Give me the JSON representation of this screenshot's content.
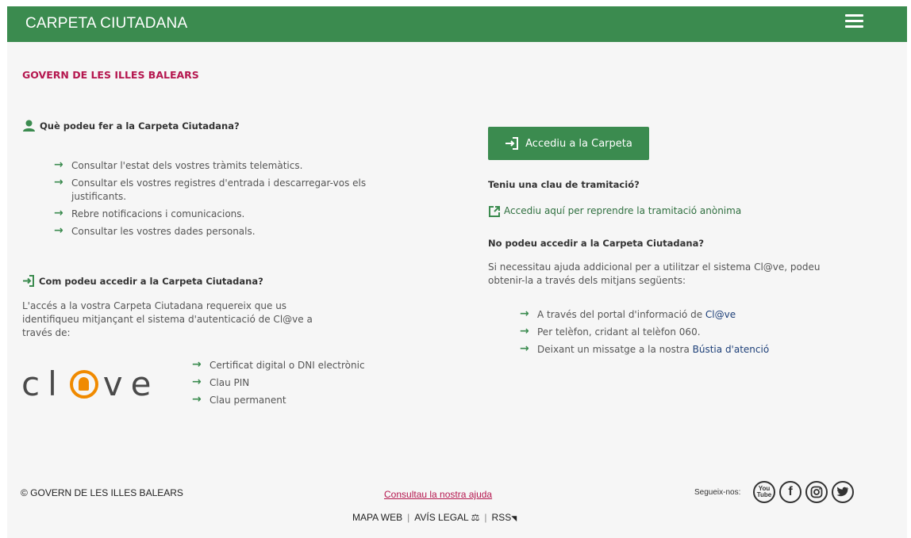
{
  "header": {
    "title": "CARPETA CIUTADANA"
  },
  "gov_name": "GOVERN DE LES ILLES BALEARS",
  "left": {
    "what_title": "Què podeu fer a la Carpeta Ciutadana?",
    "what_items": [
      "Consultar l'estat dels vostres tràmits telemàtics.",
      "Consultar els vostres registres d'entrada i descarregar-vos els justificants.",
      "Rebre notificacions i comunicacions.",
      "Consultar les vostres dades personals."
    ],
    "how_title": "Com podeu accedir a la Carpeta Ciutadana?",
    "how_text": "L'accés a la vostra Carpeta Ciutadana requereix que us identifiqueu mitjançant el sistema d'autenticació de Cl@ve a través de:",
    "clave_logo_text": "cl@ve",
    "clave_items": [
      "Certificat digital o DNI electrònic",
      "Clau PIN",
      "Clau permanent"
    ]
  },
  "right": {
    "access_button": "Accediu a la Carpeta",
    "key_title": "Teniu una clau de tramitació?",
    "key_link": "Accediu aquí per reprendre la tramitació anònima",
    "noaccess_title": "No podeu accedir a la Carpeta Ciutadana?",
    "noaccess_text": "Si necessitau ajuda addicional per a utilitzar el sistema Cl@ve, podeu obtenir-la a través dels mitjans següents:",
    "help_items": [
      {
        "text": "A través del portal d'informació de ",
        "link": "Cl@ve"
      },
      {
        "text": "Per telèfon, cridant al telèfon 060.",
        "link": ""
      },
      {
        "text": "Deixant un missatge a la nostra ",
        "link": "Bústia d'atenció"
      }
    ]
  },
  "footer": {
    "copyright": "© GOVERN DE LES ILLES BALEARS",
    "help_link": "Consultau la nostra ajuda",
    "links": [
      "MAPA WEB",
      "AVÍS LEGAL",
      "RSS"
    ],
    "follow": "Segueix-nos:",
    "social": [
      "youtube-icon",
      "facebook-icon",
      "instagram-icon",
      "twitter-icon"
    ]
  },
  "colors": {
    "brand_green": "#3b8b4f",
    "accent_red": "#b5174f",
    "clave_orange": "#f08a00"
  }
}
